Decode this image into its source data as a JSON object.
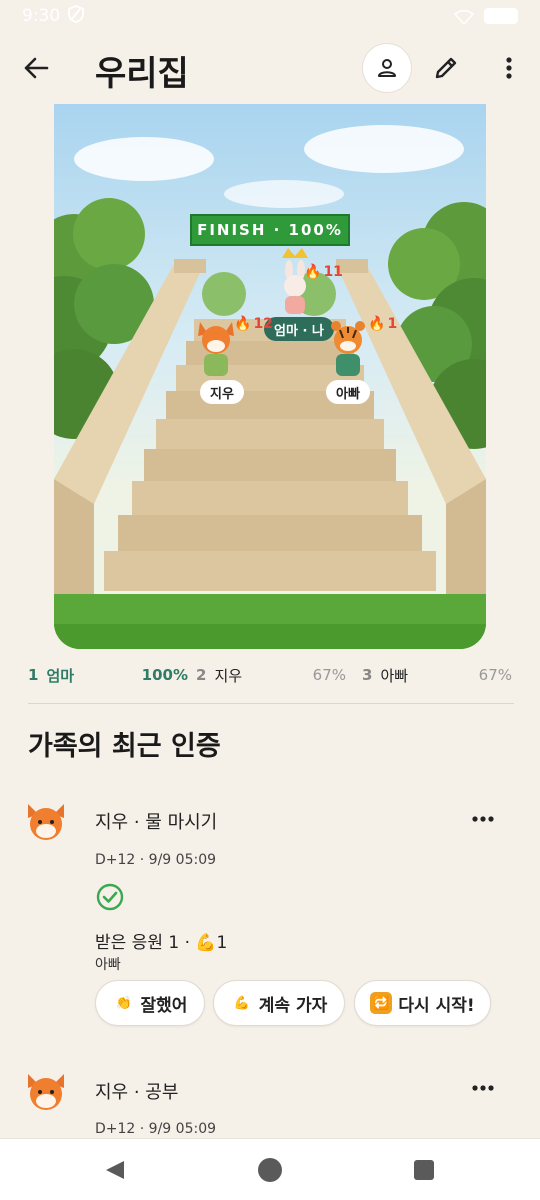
{
  "status_bar": {
    "time": "9:30"
  },
  "header": {
    "title": "우리집"
  },
  "scene": {
    "banner": "FINISH · 100%",
    "characters": [
      {
        "label": "엄마 · 나",
        "streak": "11",
        "icon": "bunny-icon"
      },
      {
        "label": "지우",
        "streak": "12",
        "icon": "fox-icon"
      },
      {
        "label": "아빠",
        "streak": "1",
        "icon": "tiger-icon"
      }
    ]
  },
  "ranking": [
    {
      "rank": "1",
      "name": "엄마",
      "pct": "100%",
      "color": "#2f7d68"
    },
    {
      "rank": "2",
      "name": "지우",
      "pct": "67%",
      "color": "#888888"
    },
    {
      "rank": "3",
      "name": "아빠",
      "pct": "67%",
      "color": "#888888"
    }
  ],
  "section": {
    "title": "가족의 최근 인증"
  },
  "feed": [
    {
      "title": "지우 · 물 마시기",
      "meta": "D+12 · 9/9 05:09",
      "cheers": "받은 응원 1 · 💪1",
      "cheerers": "아빠",
      "buttons": [
        {
          "label": "잘했어",
          "emoji": "👏"
        },
        {
          "label": "계속 가자",
          "emoji": "💪"
        },
        {
          "label": "다시 시작!",
          "emoji": "🔁"
        }
      ]
    },
    {
      "title": "지우 · 공부",
      "meta": "D+12 · 9/9 05:09"
    }
  ],
  "colors": {
    "accent": "#2f7d68",
    "background": "#f5f0e8",
    "check": "#3aa852"
  }
}
